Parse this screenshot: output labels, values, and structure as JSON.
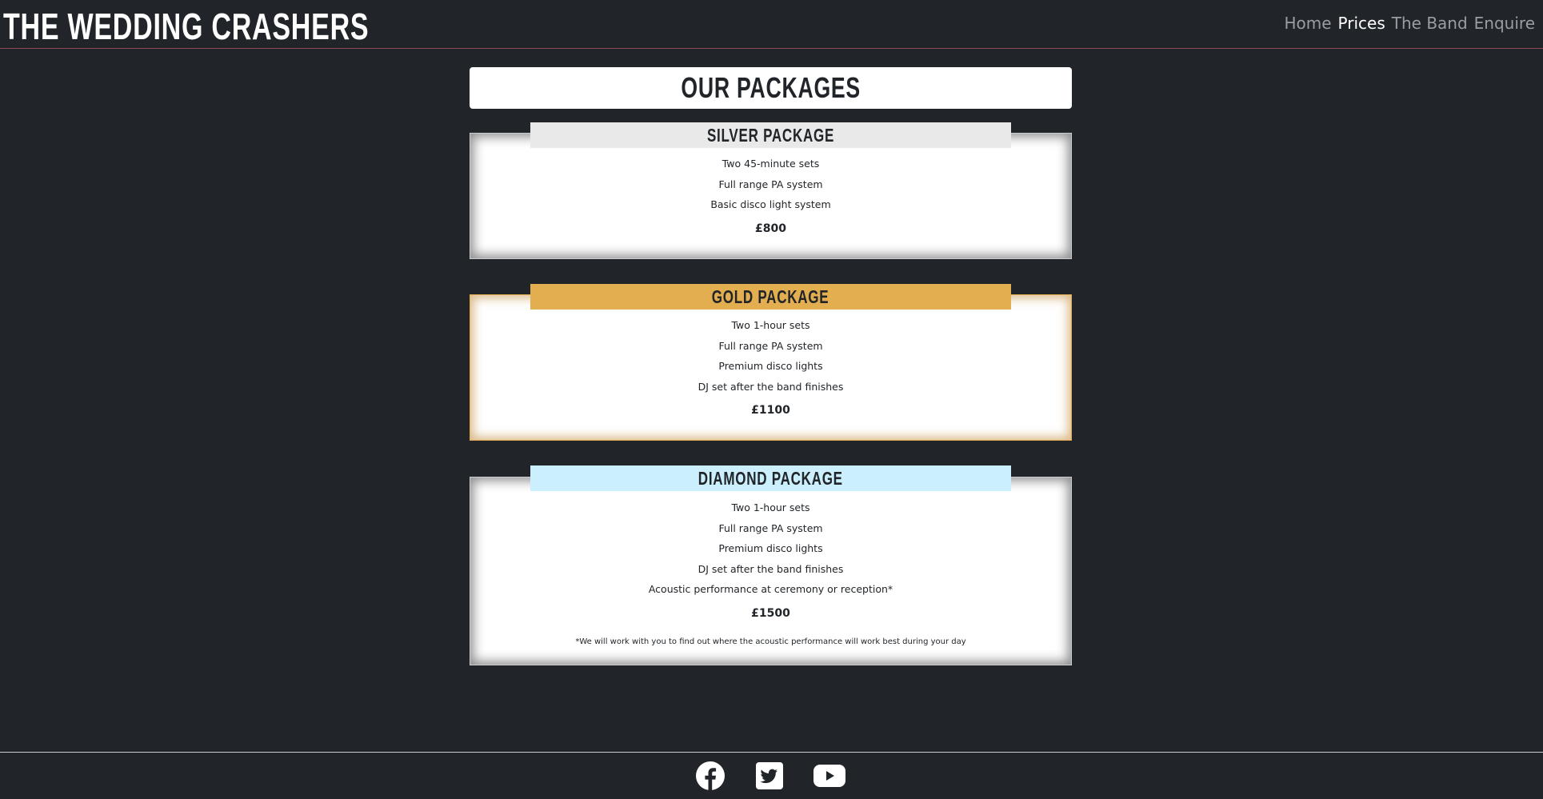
{
  "header": {
    "brand": "THE WEDDING CRASHERS",
    "nav": [
      {
        "label": "Home",
        "active": false
      },
      {
        "label": "Prices",
        "active": true
      },
      {
        "label": "The Band",
        "active": false
      },
      {
        "label": "Enquire",
        "active": false
      }
    ]
  },
  "main": {
    "title": "OUR PACKAGES",
    "packages": [
      {
        "name": "SILVER PACKAGE",
        "header_color": "#e9e9e9",
        "features": [
          "Two 45-minute sets",
          "Full range PA system",
          "Basic disco light system"
        ],
        "price": "£800"
      },
      {
        "name": "GOLD PACKAGE",
        "header_color": "#e3ae4f",
        "features": [
          "Two 1-hour sets",
          "Full range PA system",
          "Premium disco lights",
          "DJ set after the band finishes"
        ],
        "price": "£1100"
      },
      {
        "name": "DIAMOND PACKAGE",
        "header_color": "#cbeffd",
        "features": [
          "Two 1-hour sets",
          "Full range PA system",
          "Premium disco lights",
          "DJ set after the band finishes",
          "Acoustic performance at ceremony or reception*"
        ],
        "price": "£1500",
        "note": "*We will work with you to find out where the acoustic performance will work best during your day"
      }
    ]
  },
  "footer": {
    "social": [
      "facebook-icon",
      "twitter-icon",
      "youtube-icon"
    ]
  }
}
